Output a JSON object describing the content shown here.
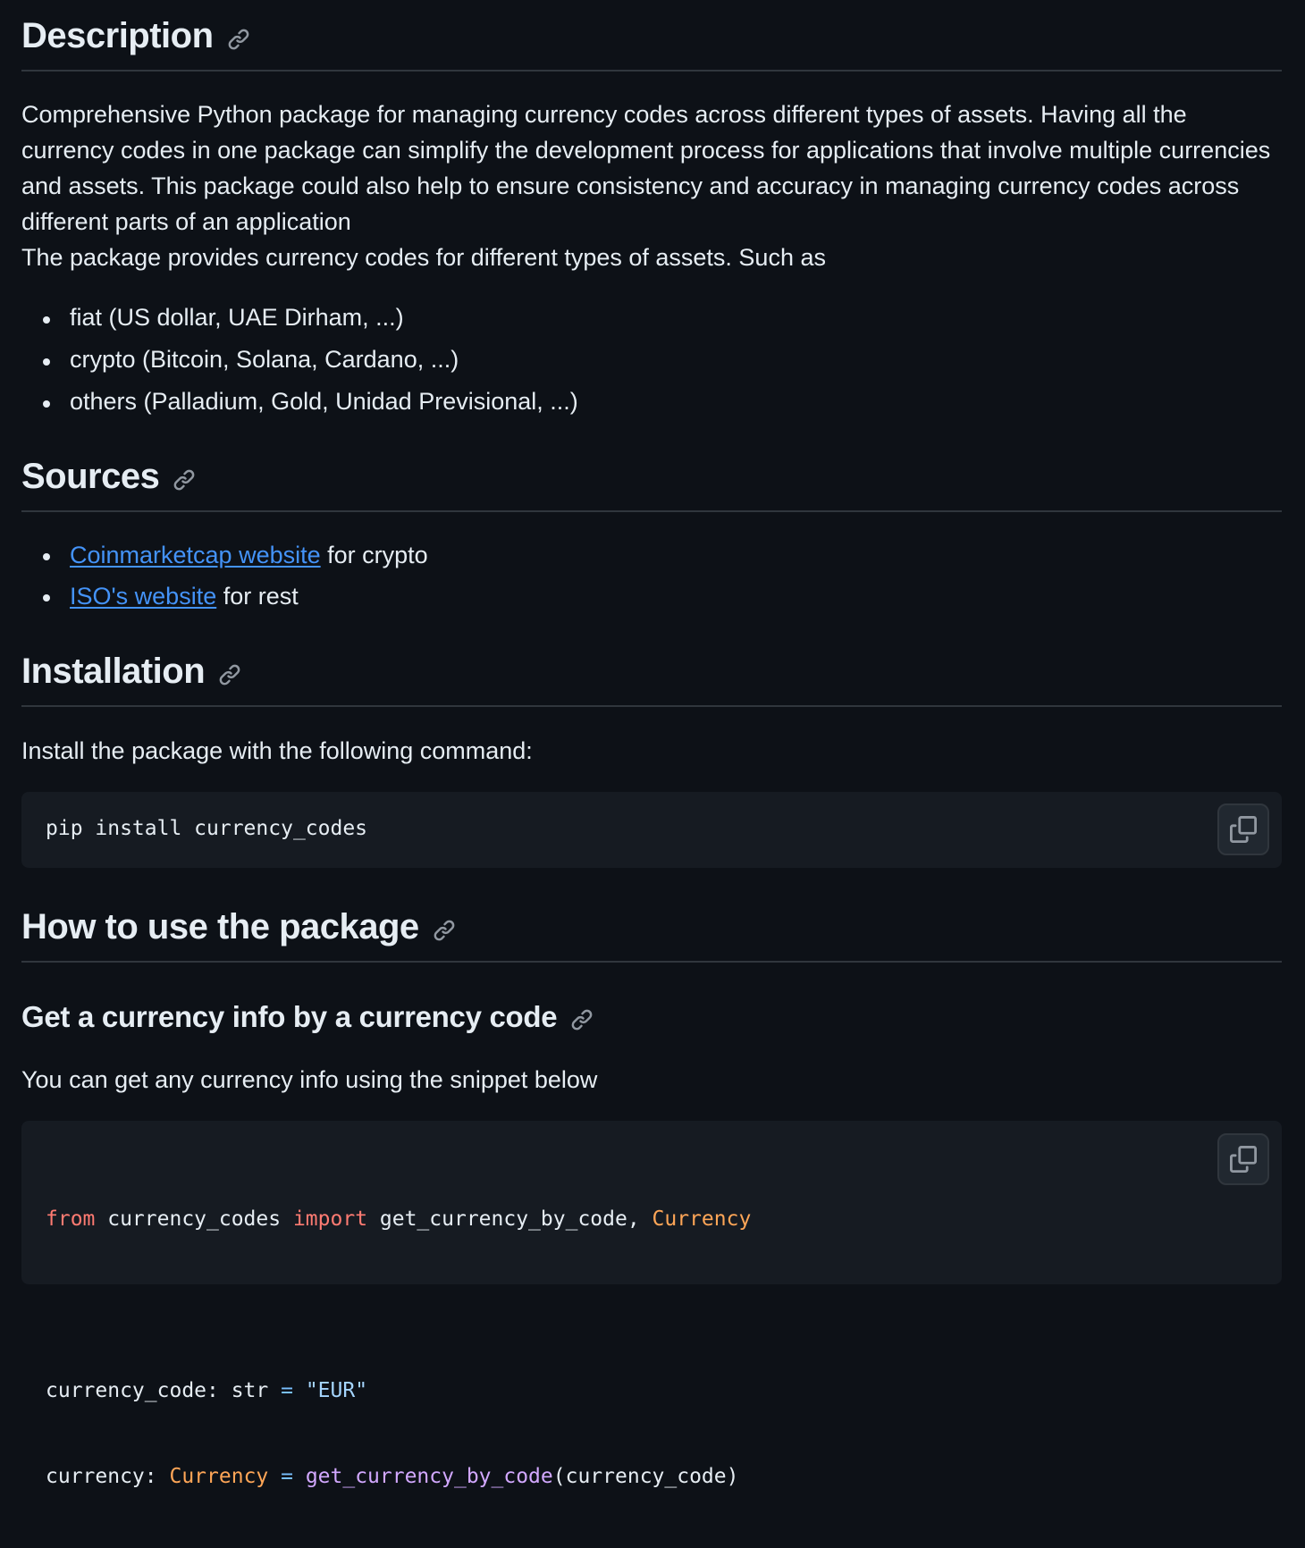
{
  "description": {
    "heading": "Description",
    "paragraph1": "Comprehensive Python package for managing currency codes across different types of assets. Having all the currency codes in one package can simplify the development process for applications that involve multiple currencies and assets. This package could also help to ensure consistency and accuracy in managing currency codes across different parts of an application",
    "paragraph2": "The package provides currency codes for different types of assets. Such as",
    "items": [
      "fiat (US dollar, UAE Dirham, ...)",
      "crypto (Bitcoin, Solana, Cardano, ...)",
      "others (Palladium, Gold, Unidad Previsional, ...)"
    ]
  },
  "sources": {
    "heading": "Sources",
    "items": [
      {
        "link": "Coinmarketcap website",
        "rest": " for crypto"
      },
      {
        "link": "ISO's website",
        "rest": " for rest"
      }
    ]
  },
  "installation": {
    "heading": "Installation",
    "intro": "Install the package with the following command:",
    "command": "pip install currency_codes"
  },
  "usage": {
    "heading": "How to use the package",
    "subheading": "Get a currency info by a currency code",
    "intro": "You can get any currency info using the snippet below",
    "code": {
      "kw_from": "from",
      "module": " currency_codes ",
      "kw_import": "import",
      "imports": " get_currency_by_code, ",
      "cls_currency": "Currency",
      "var1": "currency_code: str ",
      "eq1": "=",
      "str_eur": " \"EUR\"",
      "var2": "currency: ",
      "cls_currency2": "Currency",
      "eq2": " = ",
      "fn_call": "get_currency_by_code",
      "args": "(currency_code)"
    }
  },
  "icons": {
    "anchor": "link-icon",
    "copy": "copy-icon"
  },
  "colors": {
    "background": "#0d1117",
    "text": "#e6edf3",
    "link": "#4493f8",
    "code_bg": "#161b22",
    "keyword": "#ff7b72",
    "class": "#ffa657",
    "function": "#d2a8ff",
    "string": "#a5d6ff"
  }
}
